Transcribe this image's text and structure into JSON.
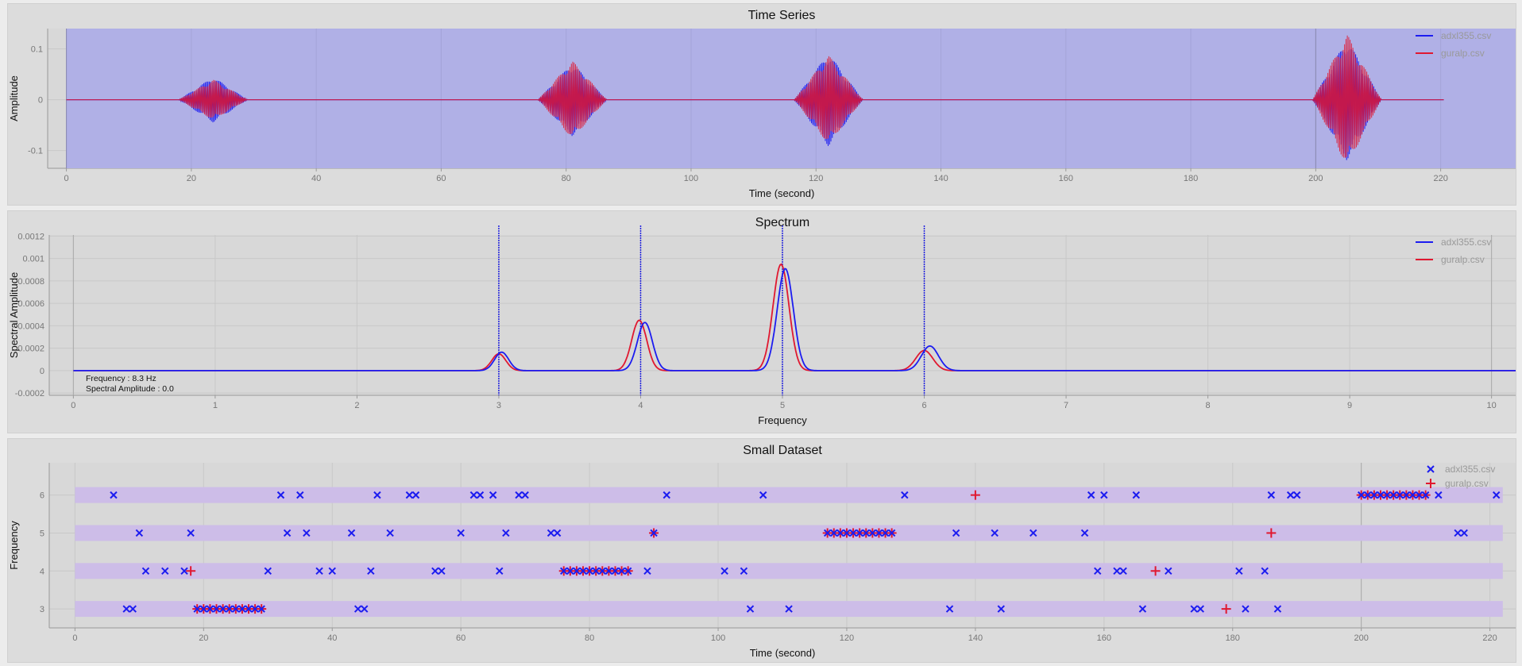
{
  "colors": {
    "adxl": "#1c1cf0",
    "guralp": "#e01830",
    "plot_bg_timeseries": "#b0b0e6",
    "band": "#cdbde8",
    "grid": "#c8c8c8"
  },
  "chart_data": [
    {
      "type": "line",
      "title": "Time Series",
      "xlabel": "Time (second)",
      "ylabel": "Amplitude",
      "xlim": [
        -3,
        232
      ],
      "ylim": [
        -0.135,
        0.14
      ],
      "xticks": [
        0,
        20,
        40,
        60,
        80,
        100,
        120,
        140,
        160,
        180,
        200,
        220
      ],
      "yticks": [
        -0.1,
        0,
        0.1
      ],
      "ytick_labels": [
        "-0.1",
        "0",
        "0.1"
      ],
      "legend": {
        "position": "top-right",
        "entries": [
          "adxl355.csv",
          "guralp.csv"
        ]
      },
      "vlines": [
        0,
        200
      ],
      "bursts": [
        {
          "x_start": 18,
          "x_end": 29,
          "adxl_amplitude": 0.045,
          "guralp_amplitude": 0.04
        },
        {
          "x_start": 75.5,
          "x_end": 86.5,
          "adxl_amplitude": 0.072,
          "guralp_amplitude": 0.077
        },
        {
          "x_start": 116.5,
          "x_end": 127.5,
          "adxl_amplitude": 0.092,
          "guralp_amplitude": 0.088
        },
        {
          "x_start": 199.5,
          "x_end": 210.5,
          "adxl_amplitude": 0.12,
          "guralp_amplitude": 0.13
        }
      ],
      "series": [
        {
          "name": "adxl355.csv",
          "x_range": [
            0,
            220.5
          ]
        },
        {
          "name": "guralp.csv",
          "x_range": [
            0,
            220.5
          ]
        }
      ]
    },
    {
      "type": "line",
      "title": "Spectrum",
      "xlabel": "Frequency",
      "ylabel": "Spectral Amplitude",
      "xlim": [
        -0.17,
        10.17
      ],
      "ylim": [
        -0.00022,
        0.00121
      ],
      "xticks": [
        0,
        1,
        2,
        3,
        4,
        5,
        6,
        7,
        8,
        9,
        10
      ],
      "yticks": [
        -0.0002,
        0,
        0.0002,
        0.0004,
        0.0006,
        0.0008,
        0.001,
        0.0012
      ],
      "ytick_labels": [
        "-0.0002",
        "0",
        "0.0002",
        "0.0004",
        "0.0006",
        "0.0008",
        "0.001",
        "0.0012"
      ],
      "legend": {
        "position": "top-right",
        "entries": [
          "adxl355.csv",
          "guralp.csv"
        ]
      },
      "marker_lines": [
        3,
        4,
        5,
        6
      ],
      "readout": {
        "frequency": "Frequency : 8.3 Hz",
        "amplitude": "Spectral Amplitude : 0.0"
      },
      "series": [
        {
          "name": "adxl355.csv",
          "peaks": [
            {
              "x": 3.02,
              "y": 0.000165,
              "width": 0.07
            },
            {
              "x": 4.03,
              "y": 0.00043,
              "width": 0.075
            },
            {
              "x": 5.02,
              "y": 0.00091,
              "width": 0.08
            },
            {
              "x": 6.04,
              "y": 0.00022,
              "width": 0.085
            }
          ]
        },
        {
          "name": "guralp.csv",
          "peaks": [
            {
              "x": 3.0,
              "y": 0.00015,
              "width": 0.07
            },
            {
              "x": 3.99,
              "y": 0.00045,
              "width": 0.075
            },
            {
              "x": 4.99,
              "y": 0.00095,
              "width": 0.08
            },
            {
              "x": 6.0,
              "y": 0.00018,
              "width": 0.085
            }
          ]
        }
      ]
    },
    {
      "type": "scatter",
      "title": "Small Dataset",
      "xlabel": "Time (second)",
      "ylabel": "Frequency",
      "xlim": [
        -4,
        224
      ],
      "ylim": [
        2.5,
        6.85
      ],
      "xticks": [
        0,
        20,
        40,
        60,
        80,
        100,
        120,
        140,
        160,
        180,
        200,
        220
      ],
      "yticks": [
        3,
        4,
        5,
        6
      ],
      "legend": {
        "position": "top-right",
        "entries": [
          "adxl355.csv",
          "guralp.csv"
        ]
      },
      "band_x_range": [
        0,
        222
      ],
      "series": [
        {
          "name": "adxl355.csv",
          "marker": "x",
          "rows": [
            {
              "y": 6,
              "x": [
                6,
                32,
                35,
                47,
                52,
                53,
                62,
                63,
                65,
                69,
                70,
                92,
                107,
                129,
                158,
                160,
                165,
                186,
                189,
                190,
                200,
                201,
                202,
                203,
                204,
                205,
                206,
                207,
                208,
                209,
                210,
                212,
                221
              ]
            },
            {
              "y": 5,
              "x": [
                10,
                18,
                33,
                36,
                43,
                49,
                60,
                67,
                74,
                75,
                90,
                117,
                118,
                119,
                120,
                121,
                122,
                123,
                124,
                125,
                126,
                127,
                137,
                143,
                149,
                157,
                215,
                216
              ]
            },
            {
              "y": 4,
              "x": [
                11,
                14,
                17,
                30,
                38,
                40,
                46,
                56,
                57,
                66,
                76,
                77,
                78,
                79,
                80,
                81,
                82,
                83,
                84,
                85,
                86,
                89,
                101,
                104,
                159,
                162,
                163,
                170,
                181,
                185
              ]
            },
            {
              "y": 3,
              "x": [
                8,
                9,
                19,
                20,
                21,
                22,
                23,
                24,
                25,
                26,
                27,
                28,
                29,
                44,
                45,
                105,
                111,
                136,
                144,
                166,
                174,
                175,
                182,
                187
              ]
            }
          ]
        },
        {
          "name": "guralp.csv",
          "marker": "+",
          "rows": [
            {
              "y": 6,
              "x": [
                140,
                200,
                201,
                202,
                203,
                204,
                205,
                206,
                207,
                208,
                209,
                210
              ]
            },
            {
              "y": 5,
              "x": [
                90,
                117,
                118,
                119,
                120,
                121,
                122,
                123,
                124,
                125,
                126,
                127,
                186
              ]
            },
            {
              "y": 4,
              "x": [
                18,
                76,
                77,
                78,
                79,
                80,
                81,
                82,
                83,
                84,
                85,
                86,
                168
              ]
            },
            {
              "y": 3,
              "x": [
                19,
                20,
                21,
                22,
                23,
                24,
                25,
                26,
                27,
                28,
                29,
                179
              ]
            }
          ]
        }
      ]
    }
  ]
}
